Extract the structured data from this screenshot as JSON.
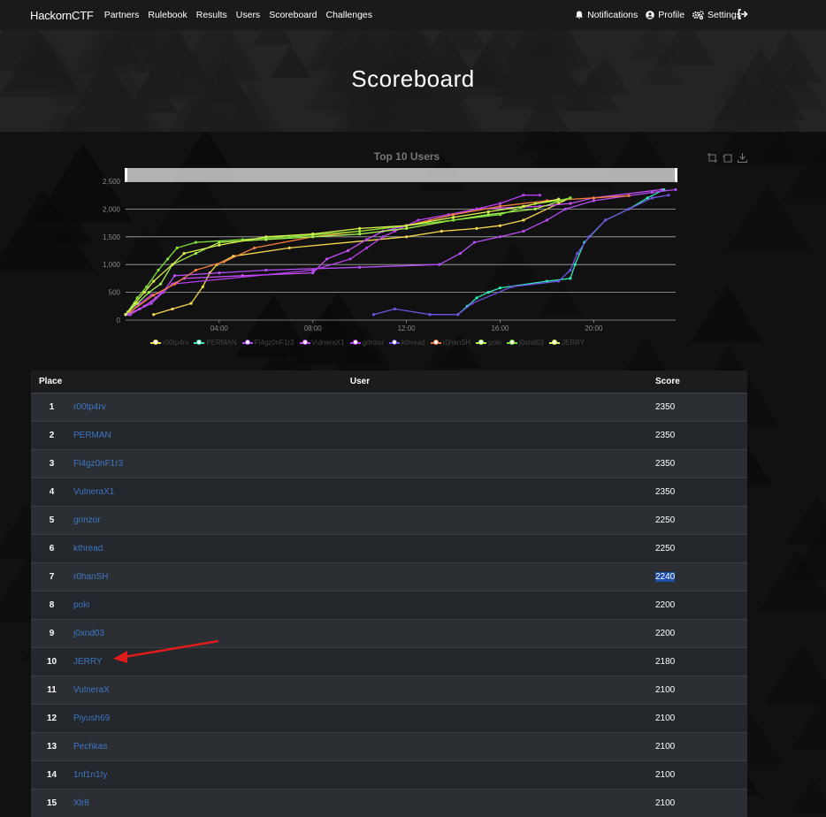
{
  "nav": {
    "brand": "HackornCTF",
    "links": [
      "Partners",
      "Rulebook",
      "Results",
      "Users",
      "Scoreboard",
      "Challenges"
    ],
    "right": {
      "notifications": "Notifications",
      "profile": "Profile",
      "settings": "Settings"
    }
  },
  "page_title": "Scoreboard",
  "chart_data": {
    "type": "line",
    "title": "Top 10 Users",
    "x_ticks": [
      "04:00",
      "08:00",
      "12:00",
      "16:00",
      "20:00"
    ],
    "y_ticks": [
      "0",
      "500",
      "1,000",
      "1,500",
      "2,000",
      "2,500"
    ],
    "ylim": [
      0,
      2500
    ],
    "xlim_hours": [
      0,
      23.5
    ],
    "grid": true,
    "legend_position": "bottom",
    "series": [
      {
        "name": "r00tp4rv",
        "color": "#f5d94d",
        "points": [
          [
            1.2,
            100
          ],
          [
            2,
            200
          ],
          [
            2.8,
            300
          ],
          [
            3.3,
            600
          ],
          [
            3.6,
            850
          ],
          [
            3.9,
            1000
          ],
          [
            4.6,
            1150
          ],
          [
            7,
            1300
          ],
          [
            12,
            1500
          ],
          [
            13.5,
            1600
          ],
          [
            15,
            1650
          ],
          [
            16,
            1700
          ],
          [
            17,
            1800
          ],
          [
            18.5,
            2100
          ],
          [
            19,
            2200
          ]
        ]
      },
      {
        "name": "PERMAN",
        "color": "#2ee8b6",
        "points": [
          [
            14.2,
            100
          ],
          [
            14.6,
            250
          ],
          [
            15,
            400
          ],
          [
            15.5,
            500
          ],
          [
            16,
            580
          ],
          [
            18,
            700
          ],
          [
            19,
            750
          ],
          [
            19.2,
            1000
          ],
          [
            19.6,
            1400
          ],
          [
            20.5,
            1800
          ],
          [
            21.5,
            2000
          ],
          [
            22.3,
            2200
          ],
          [
            23,
            2350
          ]
        ]
      },
      {
        "name": "Fl4gz0nF1r3",
        "color": "#b44df5",
        "points": [
          [
            0,
            100
          ],
          [
            0.6,
            200
          ],
          [
            1.1,
            300
          ],
          [
            1.6,
            500
          ],
          [
            2.1,
            800
          ],
          [
            4,
            850
          ],
          [
            6,
            900
          ],
          [
            10,
            950
          ],
          [
            13.4,
            1000
          ],
          [
            14.3,
            1200
          ],
          [
            14.9,
            1400
          ],
          [
            16,
            1500
          ],
          [
            17,
            1600
          ],
          [
            18,
            1800
          ],
          [
            18.8,
            2000
          ],
          [
            20,
            2150
          ],
          [
            22.5,
            2300
          ],
          [
            23.5,
            2350
          ]
        ]
      },
      {
        "name": "VulneraX1",
        "color": "#c64ef5",
        "points": [
          [
            0.2,
            100
          ],
          [
            0.8,
            250
          ],
          [
            1.3,
            400
          ],
          [
            2,
            650
          ],
          [
            2.5,
            750
          ],
          [
            5,
            800
          ],
          [
            8,
            850
          ],
          [
            8.6,
            1100
          ],
          [
            9.5,
            1250
          ],
          [
            10.3,
            1450
          ],
          [
            11,
            1600
          ],
          [
            12,
            1700
          ],
          [
            13,
            1800
          ],
          [
            14,
            1900
          ],
          [
            15,
            2000
          ],
          [
            17.7,
            2050
          ],
          [
            19,
            2100
          ],
          [
            20,
            2200
          ],
          [
            22.9,
            2350
          ]
        ]
      },
      {
        "name": "grinzor",
        "color": "#b83ef0",
        "points": [
          [
            0.1,
            100
          ],
          [
            0.6,
            300
          ],
          [
            1.1,
            450
          ],
          [
            1.6,
            500
          ],
          [
            2,
            650
          ],
          [
            8,
            900
          ],
          [
            9.6,
            1100
          ],
          [
            10.3,
            1300
          ],
          [
            11,
            1500
          ],
          [
            11.5,
            1600
          ],
          [
            12,
            1700
          ],
          [
            12.5,
            1800
          ],
          [
            13.8,
            1900
          ],
          [
            15,
            2000
          ],
          [
            16,
            2100
          ],
          [
            17,
            2250
          ],
          [
            17.7,
            2250
          ]
        ]
      },
      {
        "name": "kthread",
        "color": "#6e52e0",
        "points": [
          [
            10.6,
            100
          ],
          [
            11.5,
            200
          ],
          [
            13,
            100
          ],
          [
            14.2,
            100
          ],
          [
            14.8,
            300
          ],
          [
            16.5,
            600
          ],
          [
            18.5,
            700
          ],
          [
            19,
            900
          ],
          [
            19.3,
            1200
          ],
          [
            19.8,
            1500
          ],
          [
            20.5,
            1800
          ],
          [
            21.5,
            2000
          ],
          [
            22.5,
            2200
          ],
          [
            23.2,
            2250
          ]
        ]
      },
      {
        "name": "r0hanSH",
        "color": "#f07e3a",
        "points": [
          [
            0.2,
            150
          ],
          [
            1.2,
            450
          ],
          [
            2.1,
            650
          ],
          [
            3,
            900
          ],
          [
            4.2,
            1050
          ],
          [
            5.5,
            1300
          ],
          [
            8,
            1500
          ],
          [
            10,
            1600
          ],
          [
            12,
            1700
          ],
          [
            14,
            1900
          ],
          [
            16,
            2050
          ],
          [
            18,
            2150
          ],
          [
            20,
            2200
          ],
          [
            21.5,
            2240
          ]
        ]
      },
      {
        "name": "poki",
        "color": "#a8f04d",
        "points": [
          [
            0,
            100
          ],
          [
            0.5,
            300
          ],
          [
            1,
            500
          ],
          [
            1.5,
            650
          ],
          [
            2,
            1000
          ],
          [
            3,
            1200
          ],
          [
            4,
            1400
          ],
          [
            6,
            1450
          ],
          [
            8,
            1500
          ],
          [
            10,
            1550
          ],
          [
            12,
            1650
          ],
          [
            14,
            1800
          ],
          [
            15.5,
            1900
          ],
          [
            17.5,
            2000
          ],
          [
            19,
            2200
          ]
        ]
      },
      {
        "name": "j0xnd03",
        "color": "#7fe03a",
        "points": [
          [
            0.1,
            150
          ],
          [
            0.5,
            400
          ],
          [
            0.9,
            600
          ],
          [
            1.4,
            900
          ],
          [
            1.8,
            1100
          ],
          [
            2.2,
            1300
          ],
          [
            3,
            1400
          ],
          [
            5,
            1450
          ],
          [
            7,
            1500
          ],
          [
            10,
            1600
          ],
          [
            12,
            1700
          ],
          [
            14,
            1800
          ],
          [
            16,
            1900
          ],
          [
            17.5,
            2100
          ],
          [
            18.5,
            2150
          ],
          [
            19,
            2200
          ]
        ]
      },
      {
        "name": "JERRY",
        "color": "#d9f04d",
        "points": [
          [
            0,
            100
          ],
          [
            0.4,
            300
          ],
          [
            0.8,
            500
          ],
          [
            1.2,
            700
          ],
          [
            2,
            1000
          ],
          [
            2.5,
            1200
          ],
          [
            4,
            1350
          ],
          [
            6,
            1500
          ],
          [
            8,
            1550
          ],
          [
            10,
            1650
          ],
          [
            12,
            1700
          ],
          [
            14,
            1850
          ],
          [
            15.5,
            1950
          ],
          [
            17,
            2050
          ],
          [
            18.5,
            2180
          ]
        ]
      }
    ]
  },
  "table": {
    "headers": {
      "place": "Place",
      "user": "User",
      "score": "Score"
    },
    "rows": [
      {
        "place": "1",
        "user": "r00tp4rv",
        "score": "2350"
      },
      {
        "place": "2",
        "user": "PERMAN",
        "score": "2350"
      },
      {
        "place": "3",
        "user": "Fl4gz0nF1r3",
        "score": "2350"
      },
      {
        "place": "4",
        "user": "VulneraX1",
        "score": "2350"
      },
      {
        "place": "5",
        "user": "grinzor",
        "score": "2250"
      },
      {
        "place": "6",
        "user": "kthread",
        "score": "2250"
      },
      {
        "place": "7",
        "user": "r0hanSH",
        "score": "2240"
      },
      {
        "place": "8",
        "user": "poki",
        "score": "2200"
      },
      {
        "place": "9",
        "user": "j0xnd03",
        "score": "2200"
      },
      {
        "place": "10",
        "user": "JERRY",
        "score": "2180"
      },
      {
        "place": "11",
        "user": "VulneraX",
        "score": "2100"
      },
      {
        "place": "12",
        "user": "Piyush69",
        "score": "2100"
      },
      {
        "place": "13",
        "user": "Pechkas",
        "score": "2100"
      },
      {
        "place": "14",
        "user": "1nf1n1ty",
        "score": "2100"
      },
      {
        "place": "15",
        "user": "Xlr8",
        "score": "2100"
      }
    ],
    "highlighted_score_row": 6
  }
}
